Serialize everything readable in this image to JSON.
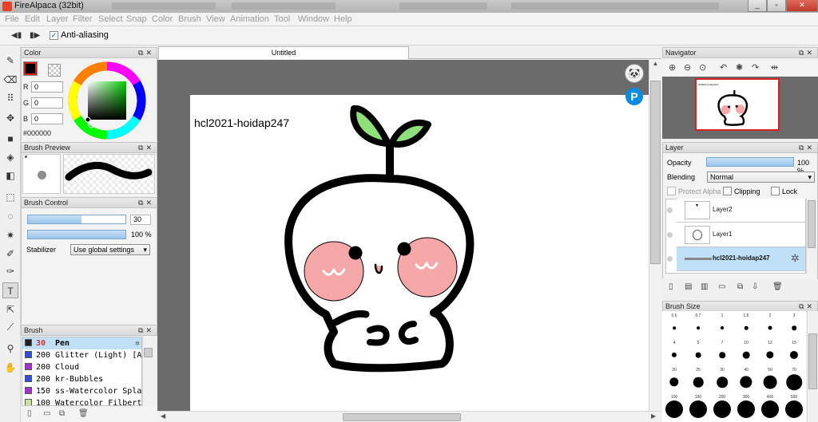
{
  "window": {
    "title": "FireAlpaca (32bit)",
    "controls": {
      "minimize": "_",
      "maximize": "▫",
      "close": "✕"
    }
  },
  "menu": [
    "File",
    "Edit",
    "Layer",
    "Filter",
    "Select",
    "Snap",
    "Color",
    "Brush",
    "View",
    "Animation",
    "Tool",
    "Window",
    "Help"
  ],
  "tool_options": {
    "anti_aliasing_label": "Anti-aliasing",
    "anti_aliasing_checked": true
  },
  "panels": {
    "color": {
      "title": "Color",
      "r_label": "R",
      "g_label": "G",
      "b_label": "B",
      "r": "0",
      "g": "0",
      "b": "0",
      "hex": "#000000",
      "foreground": "#000000"
    },
    "brush_preview": {
      "title": "Brush Preview"
    },
    "brush_control": {
      "title": "Brush Control",
      "size": "30",
      "size_fraction": 0.55,
      "opacity": "100 %",
      "opacity_fraction": 1.0,
      "stabilizer_label": "Stabilizer",
      "stabilizer_value": "Use global settings"
    },
    "brush": {
      "title": "Brush",
      "items": [
        {
          "size": "30",
          "name": "Pen",
          "color": "#1f1f1f",
          "selected": true
        },
        {
          "size": "200",
          "name": "Glitter (Light) [Add]",
          "color": "#2f4fe0"
        },
        {
          "size": "200",
          "name": "Cloud",
          "color": "#a62fd6"
        },
        {
          "size": "200",
          "name": "kr-Bubbles",
          "color": "#2f4fe0"
        },
        {
          "size": "150",
          "name": "ss-Watercolor Splash [Add]",
          "color": "#a62fd6"
        },
        {
          "size": "100",
          "name": "Watercolor Filbert",
          "color": "#c8e6a0"
        }
      ]
    },
    "navigator": {
      "title": "Navigator"
    },
    "layer": {
      "title": "Layer",
      "opacity_label": "Opacity",
      "opacity_value": "100 %",
      "opacity_fraction": 1.0,
      "blending_label": "Blending",
      "blending_value": "Normal",
      "protect_alpha_label": "Protect Alpha",
      "clipping_label": "Clipping",
      "lock_label": "Lock",
      "layers": [
        {
          "name": "Layer2"
        },
        {
          "name": "Layer1"
        },
        {
          "name": "hcl2021-hoidap247",
          "selected": true
        }
      ]
    },
    "brush_size": {
      "title": "Brush Size",
      "sizes": [
        "0.6",
        "0.7",
        "1",
        "1.5",
        "2",
        "3",
        "4",
        "5",
        "7",
        "10",
        "12",
        "15",
        "20",
        "25",
        "30",
        "40",
        "50",
        "70",
        "100",
        "150",
        "200",
        "300",
        "400",
        "500"
      ]
    }
  },
  "document": {
    "tab_title": "Untitled",
    "canvas_text": "hcl2021-hoidap247",
    "colors": {
      "stroke": "#000000",
      "leaf": "#8ee07b",
      "blush": "#f6a7a7",
      "blush_mark": "#ffffff",
      "tongue": "#f7a8a8"
    }
  }
}
